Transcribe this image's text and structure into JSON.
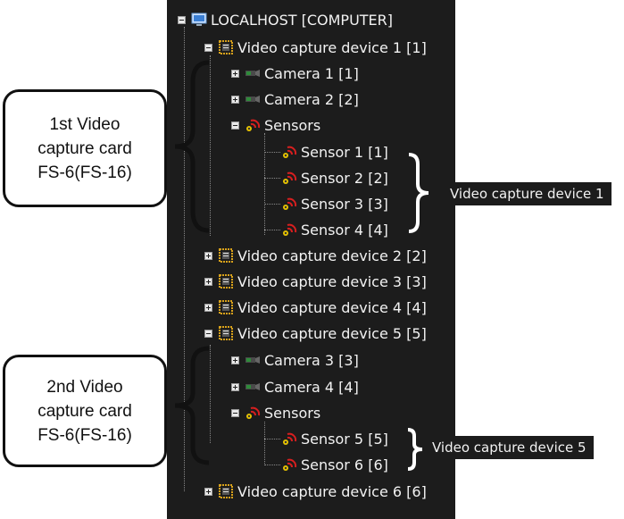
{
  "tree": {
    "root": {
      "label": "LOCALHOST [COMPUTER]",
      "icon": "monitor-icon",
      "expanded": true
    },
    "devices": [
      {
        "label": "Video capture device 1 [1]",
        "expanded": true,
        "cameras": [
          "Camera 1 [1]",
          "Camera 2 [2]"
        ],
        "sensors_label": "Sensors",
        "sensors": [
          "Sensor 1 [1]",
          "Sensor 2 [2]",
          "Sensor 3 [3]",
          "Sensor 4 [4]"
        ]
      },
      {
        "label": "Video capture device 2 [2]",
        "expanded": false
      },
      {
        "label": "Video capture device 3 [3]",
        "expanded": false
      },
      {
        "label": "Video capture device 4 [4]",
        "expanded": false
      },
      {
        "label": "Video capture device 5 [5]",
        "expanded": true,
        "cameras": [
          "Camera 3 [3]",
          "Camera 4 [4]"
        ],
        "sensors_label": "Sensors",
        "sensors": [
          "Sensor 5 [5]",
          "Sensor 6 [6]"
        ]
      },
      {
        "label": "Video capture device 6 [6]",
        "expanded": false
      }
    ]
  },
  "annotations": {
    "card1": "1st Video\ncapture card\nFS-6(FS-16)",
    "card2": "2nd Video\ncapture card\nFS-6(FS-16)",
    "group1": "Video capture device 1",
    "group5": "Video capture device 5"
  },
  "colors": {
    "panel": "#1c1c1c",
    "text": "#f2f2f2",
    "device_icon": "#d9a21b",
    "sensor_icon": "#d81f1f",
    "camera_icon": "#2e8b3a"
  }
}
